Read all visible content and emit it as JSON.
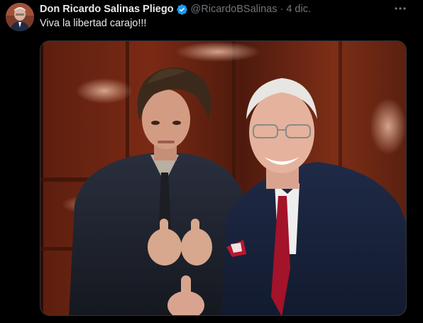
{
  "tweet": {
    "author": {
      "name": "Don Ricardo Salinas Pliego",
      "handle": "@RicardoBSalinas",
      "verified": true
    },
    "separator": "·",
    "date": "4 dic.",
    "text": "Viva la libertad carajo!!!",
    "more_icon": "more-horizontal-icon",
    "media": {
      "type": "photo",
      "description_icon": "photo-selfie"
    }
  },
  "colors": {
    "background": "#000000",
    "text_primary": "#e7e9ea",
    "text_secondary": "#71767b",
    "verified_blue": "#1d9bf0",
    "media_border": "#2f3336"
  }
}
